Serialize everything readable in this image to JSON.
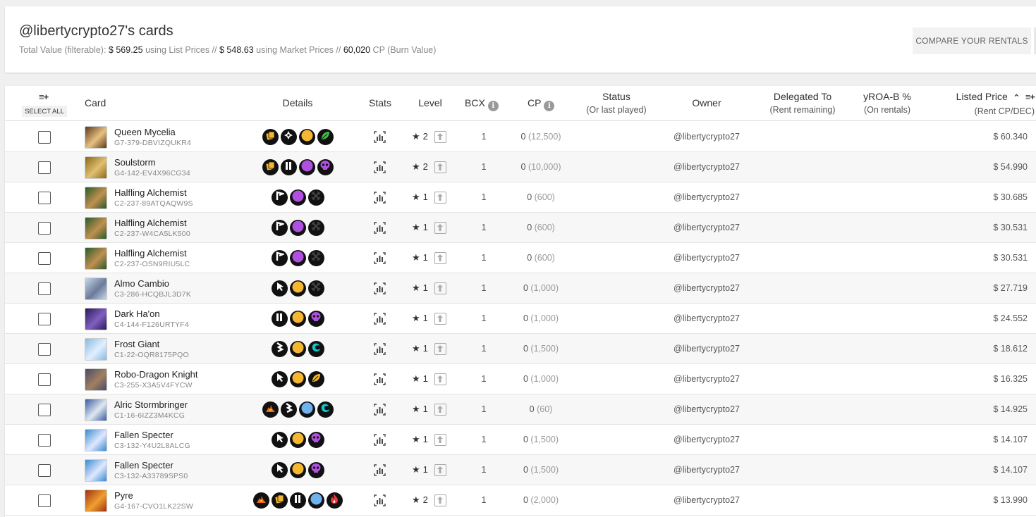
{
  "header": {
    "title": "@libertycrypto27's cards",
    "total_value_label": "Total Value (filterable):",
    "list_value": "$ 569.25",
    "list_label": "using List Prices //",
    "market_value": "$ 548.63",
    "market_label": "using Market Prices //",
    "cp_value": "60,020",
    "cp_label": "CP (Burn Value)",
    "compare_button": "COMPARE YOUR RENTALS"
  },
  "columns": {
    "select_icon": "≡+",
    "select_all": "SELECT ALL",
    "card": "Card",
    "details": "Details",
    "stats": "Stats",
    "level": "Level",
    "bcx": "BCX",
    "cp": "CP",
    "status": "Status",
    "status_sub": "(Or last played)",
    "owner": "Owner",
    "delegated": "Delegated To",
    "delegated_sub": "(Rent remaining)",
    "yroa": "yROA-B %",
    "yroa_sub": "(On rentals)",
    "price": "Listed Price",
    "price_sub": "(Rent CP/DEC)",
    "sort_icon": "⌃",
    "price_menu_icon": "≡+"
  },
  "colors": {
    "gold": "#f5b731",
    "purple": "#b150e0",
    "lightblue": "#6fb3ee",
    "teal": "#10c8d0",
    "green": "#3fc43f"
  },
  "rows": [
    {
      "name": "Queen Mycelia",
      "uid": "G7-379-DBVIZQUKR4",
      "level": "2",
      "bcx": "1",
      "cp": "0",
      "cp_burn": "(12,500)",
      "owner": "@libertycrypto27",
      "price": "$ 60.340",
      "thumb": [
        "#5a3a1e",
        "#e8c080"
      ],
      "icons": [
        "gold-card",
        "neutral-cross",
        "gold-dot",
        "green-leaf"
      ]
    },
    {
      "name": "Soulstorm",
      "uid": "G4-142-EV4X96CG34",
      "level": "2",
      "bcx": "1",
      "cp": "0",
      "cp_burn": "(10,000)",
      "owner": "@libertycrypto27",
      "price": "$ 54.990",
      "thumb": [
        "#8a6a1a",
        "#e0c070"
      ],
      "icons": [
        "gold-card",
        "pause",
        "purple-dot",
        "purple-skull"
      ]
    },
    {
      "name": "Halfling Alchemist",
      "uid": "C2-237-89ATQAQW9S",
      "level": "1",
      "bcx": "1",
      "cp": "0",
      "cp_burn": "(600)",
      "owner": "@libertycrypto27",
      "price": "$ 30.685",
      "thumb": [
        "#2a5a2a",
        "#c09050"
      ],
      "icons": [
        "flag",
        "purple-dot",
        "crossed-swords"
      ]
    },
    {
      "name": "Halfling Alchemist",
      "uid": "C2-237-W4CA5LK500",
      "level": "1",
      "bcx": "1",
      "cp": "0",
      "cp_burn": "(600)",
      "owner": "@libertycrypto27",
      "price": "$ 30.531",
      "thumb": [
        "#2a5a2a",
        "#c09050"
      ],
      "icons": [
        "flag",
        "purple-dot",
        "crossed-swords"
      ]
    },
    {
      "name": "Halfling Alchemist",
      "uid": "C2-237-OSN9RIU5LC",
      "level": "1",
      "bcx": "1",
      "cp": "0",
      "cp_burn": "(600)",
      "owner": "@libertycrypto27",
      "price": "$ 30.531",
      "thumb": [
        "#2a5a2a",
        "#c09050"
      ],
      "icons": [
        "flag",
        "purple-dot",
        "crossed-swords"
      ]
    },
    {
      "name": "Almo Cambio",
      "uid": "C3-286-HCQBJL3D7K",
      "level": "1",
      "bcx": "1",
      "cp": "0",
      "cp_burn": "(1,000)",
      "owner": "@libertycrypto27",
      "price": "$ 27.719",
      "thumb": [
        "#c8d8e8",
        "#6a7a9a"
      ],
      "icons": [
        "cursor",
        "gold-dot",
        "crossed-swords"
      ]
    },
    {
      "name": "Dark Ha'on",
      "uid": "C4-144-F126URTYF4",
      "level": "1",
      "bcx": "1",
      "cp": "0",
      "cp_burn": "(1,000)",
      "owner": "@libertycrypto27",
      "price": "$ 24.552",
      "thumb": [
        "#2a1a5a",
        "#8060c0"
      ],
      "icons": [
        "pause",
        "gold-dot",
        "purple-skull"
      ]
    },
    {
      "name": "Frost Giant",
      "uid": "C1-22-OQR8175PQO",
      "level": "1",
      "bcx": "1",
      "cp": "0",
      "cp_burn": "(1,500)",
      "owner": "@libertycrypto27",
      "price": "$ 18.612",
      "thumb": [
        "#8ab8e0",
        "#e0f0ff"
      ],
      "icons": [
        "chevrons",
        "gold-dot",
        "teal-wave"
      ]
    },
    {
      "name": "Robo-Dragon Knight",
      "uid": "C3-255-X3A5V4FYCW",
      "level": "1",
      "bcx": "1",
      "cp": "0",
      "cp_burn": "(1,000)",
      "owner": "@libertycrypto27",
      "price": "$ 16.325",
      "thumb": [
        "#4a4a6a",
        "#a08060"
      ],
      "icons": [
        "cursor",
        "gold-dot",
        "gold-leaf"
      ]
    },
    {
      "name": "Alric Stormbringer",
      "uid": "C1-16-6IZZ3M4KCG",
      "level": "1",
      "bcx": "1",
      "cp": "0",
      "cp_burn": "(60)",
      "owner": "@libertycrypto27",
      "price": "$ 14.925",
      "thumb": [
        "#3a5aa0",
        "#e0e8f0"
      ],
      "icons": [
        "fire-spark",
        "chevrons",
        "lightblue-dot",
        "teal-wave"
      ]
    },
    {
      "name": "Fallen Specter",
      "uid": "C3-132-Y4U2L8ALCG",
      "level": "1",
      "bcx": "1",
      "cp": "0",
      "cp_burn": "(1,500)",
      "owner": "@libertycrypto27",
      "price": "$ 14.107",
      "thumb": [
        "#3a8ad0",
        "#e0e8ff"
      ],
      "icons": [
        "cursor",
        "gold-dot",
        "purple-skull"
      ]
    },
    {
      "name": "Fallen Specter",
      "uid": "C3-132-A33789SPS0",
      "level": "1",
      "bcx": "1",
      "cp": "0",
      "cp_burn": "(1,500)",
      "owner": "@libertycrypto27",
      "price": "$ 14.107",
      "thumb": [
        "#3a8ad0",
        "#e0e8ff"
      ],
      "icons": [
        "cursor",
        "gold-dot",
        "purple-skull"
      ]
    },
    {
      "name": "Pyre",
      "uid": "G4-167-CVO1LK22SW",
      "level": "2",
      "bcx": "1",
      "cp": "0",
      "cp_burn": "(2,000)",
      "owner": "@libertycrypto27",
      "price": "$ 13.990",
      "thumb": [
        "#a03010",
        "#f0a030"
      ],
      "icons": [
        "fire-spark",
        "gold-card",
        "pause",
        "lightblue-dot",
        "red-fire"
      ]
    }
  ]
}
